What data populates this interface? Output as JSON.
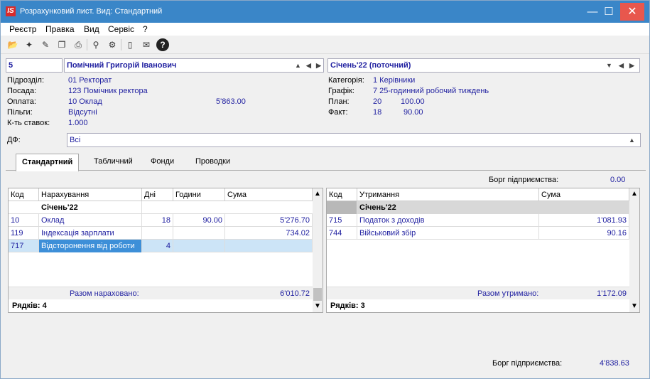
{
  "window": {
    "title": "Розрахунковий лист. Вид: Стандартний",
    "app_icon": "IS",
    "minimize": "—",
    "maximize": "☐",
    "close": "✕"
  },
  "menu": [
    "Реєстр",
    "Правка",
    "Вид",
    "Сервіс",
    "?"
  ],
  "toolbar_icons": [
    "open-icon",
    "new-icon",
    "edit-icon",
    "copy-icon",
    "print-icon",
    "search-icon",
    "settings-icon",
    "document-icon",
    "mail-icon",
    "help-icon"
  ],
  "employee": {
    "code": "5",
    "name": "Помічний Григорій Іванович"
  },
  "period": {
    "label": "Січень'22 (поточний)"
  },
  "left_info": {
    "subdivision_label": "Підрозділ:",
    "subdivision_value": "01 Ректорат",
    "position_label": "Посада:",
    "position_value": "123 Помічник ректора",
    "pay_label": "Оплата:",
    "pay_value": "10 Оклад",
    "pay_amount": "5'863.00",
    "benefits_label": "Пільги:",
    "benefits_value": "Відсутні",
    "rates_label": "К-ть ставок:",
    "rates_value": "1.000"
  },
  "right_info": {
    "category_label": "Категорія:",
    "category_value": "1 Керівники",
    "schedule_label": "Графік:",
    "schedule_value": "7 25-годинний робочий тиждень",
    "plan_label": "План:",
    "plan_days": "20",
    "plan_hours": "100.00",
    "fact_label": "Факт:",
    "fact_days": "18",
    "fact_hours": "90.00"
  },
  "df": {
    "label": "ДФ:",
    "value": "Всі"
  },
  "tabs": [
    "Стандартний",
    "Табличний",
    "Фонди",
    "Проводки"
  ],
  "debt_top": {
    "label": "Борг підприємства:",
    "value": "0.00"
  },
  "accruals": {
    "headers": [
      "Код",
      "Нарахування",
      "Дні",
      "Години",
      "Сума"
    ],
    "group": "Січень'22",
    "rows": [
      {
        "code": "10",
        "name": "Оклад",
        "days": "18",
        "hours": "90.00",
        "sum": "5'276.70"
      },
      {
        "code": "119",
        "name": "Індексація зарплати",
        "days": "",
        "hours": "",
        "sum": "734.02"
      },
      {
        "code": "717",
        "name": "Відсторонення від роботи",
        "days": "4",
        "hours": "",
        "sum": ""
      }
    ],
    "total_label": "Разом нараховано:",
    "total_value": "6'010.72",
    "rows_count": "Рядків: 4"
  },
  "deductions": {
    "headers": [
      "Код",
      "Утримання",
      "Сума"
    ],
    "group": "Січень'22",
    "rows": [
      {
        "code": "715",
        "name": "Податок з доходів",
        "sum": "1'081.93"
      },
      {
        "code": "744",
        "name": "Військовий збір",
        "sum": "90.16"
      }
    ],
    "total_label": "Разом утримано:",
    "total_value": "1'172.09",
    "rows_count": "Рядків: 3"
  },
  "debt_bottom": {
    "label": "Борг підприємства:",
    "value": "4'838.63"
  }
}
